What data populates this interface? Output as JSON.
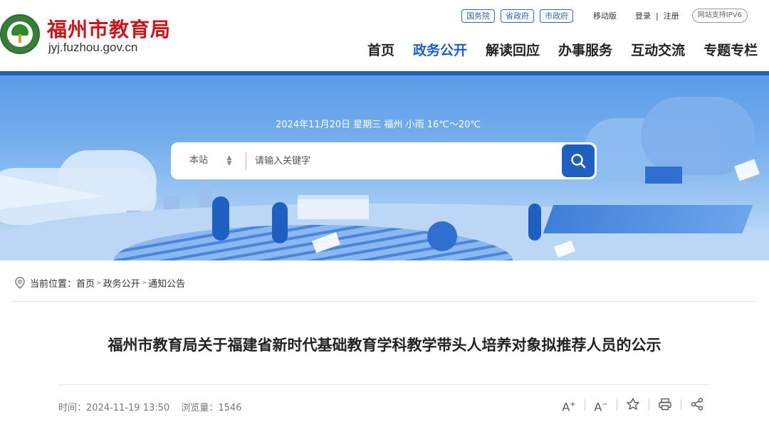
{
  "header": {
    "site_name": "福州市教育局",
    "site_url": "jyj.fuzhou.gov.cn",
    "top_links": [
      "国务院",
      "省政府",
      "市政府"
    ],
    "mobile_label": "移动版",
    "login_label": "登录",
    "separator": "|",
    "register_label": "注册",
    "ipv6_label": "网站支持IPV6",
    "nav": [
      "首页",
      "政务公开",
      "解读回应",
      "办事服务",
      "互动交流",
      "专题专栏"
    ],
    "active_nav": "政务公开"
  },
  "banner": {
    "date_line": "2024年11月20日  星期三  福州 小雨 16℃～20℃",
    "search": {
      "scope": "本站",
      "placeholder": "请输入关键字",
      "scope_icon": "updown-arrow-icon",
      "button_icon": "search-icon"
    }
  },
  "breadcrumb": {
    "prefix": "当前位置：",
    "items": [
      "首页",
      "政务公开",
      "通知公告"
    ]
  },
  "article": {
    "title": "福州市教育局关于福建省新时代基础教育学科教学带头人培养对象拟推荐人员的公示",
    "time_label": "时间：",
    "time": "2024-11-19 13:50",
    "views_label": "浏览量：",
    "views": "1546",
    "tools": [
      "font-increase-icon",
      "font-decrease-icon",
      "favorite-star-icon",
      "print-icon",
      "share-icon"
    ]
  },
  "colors": {
    "brand_red": "#c8161d",
    "brand_blue": "#1f5fbf"
  }
}
